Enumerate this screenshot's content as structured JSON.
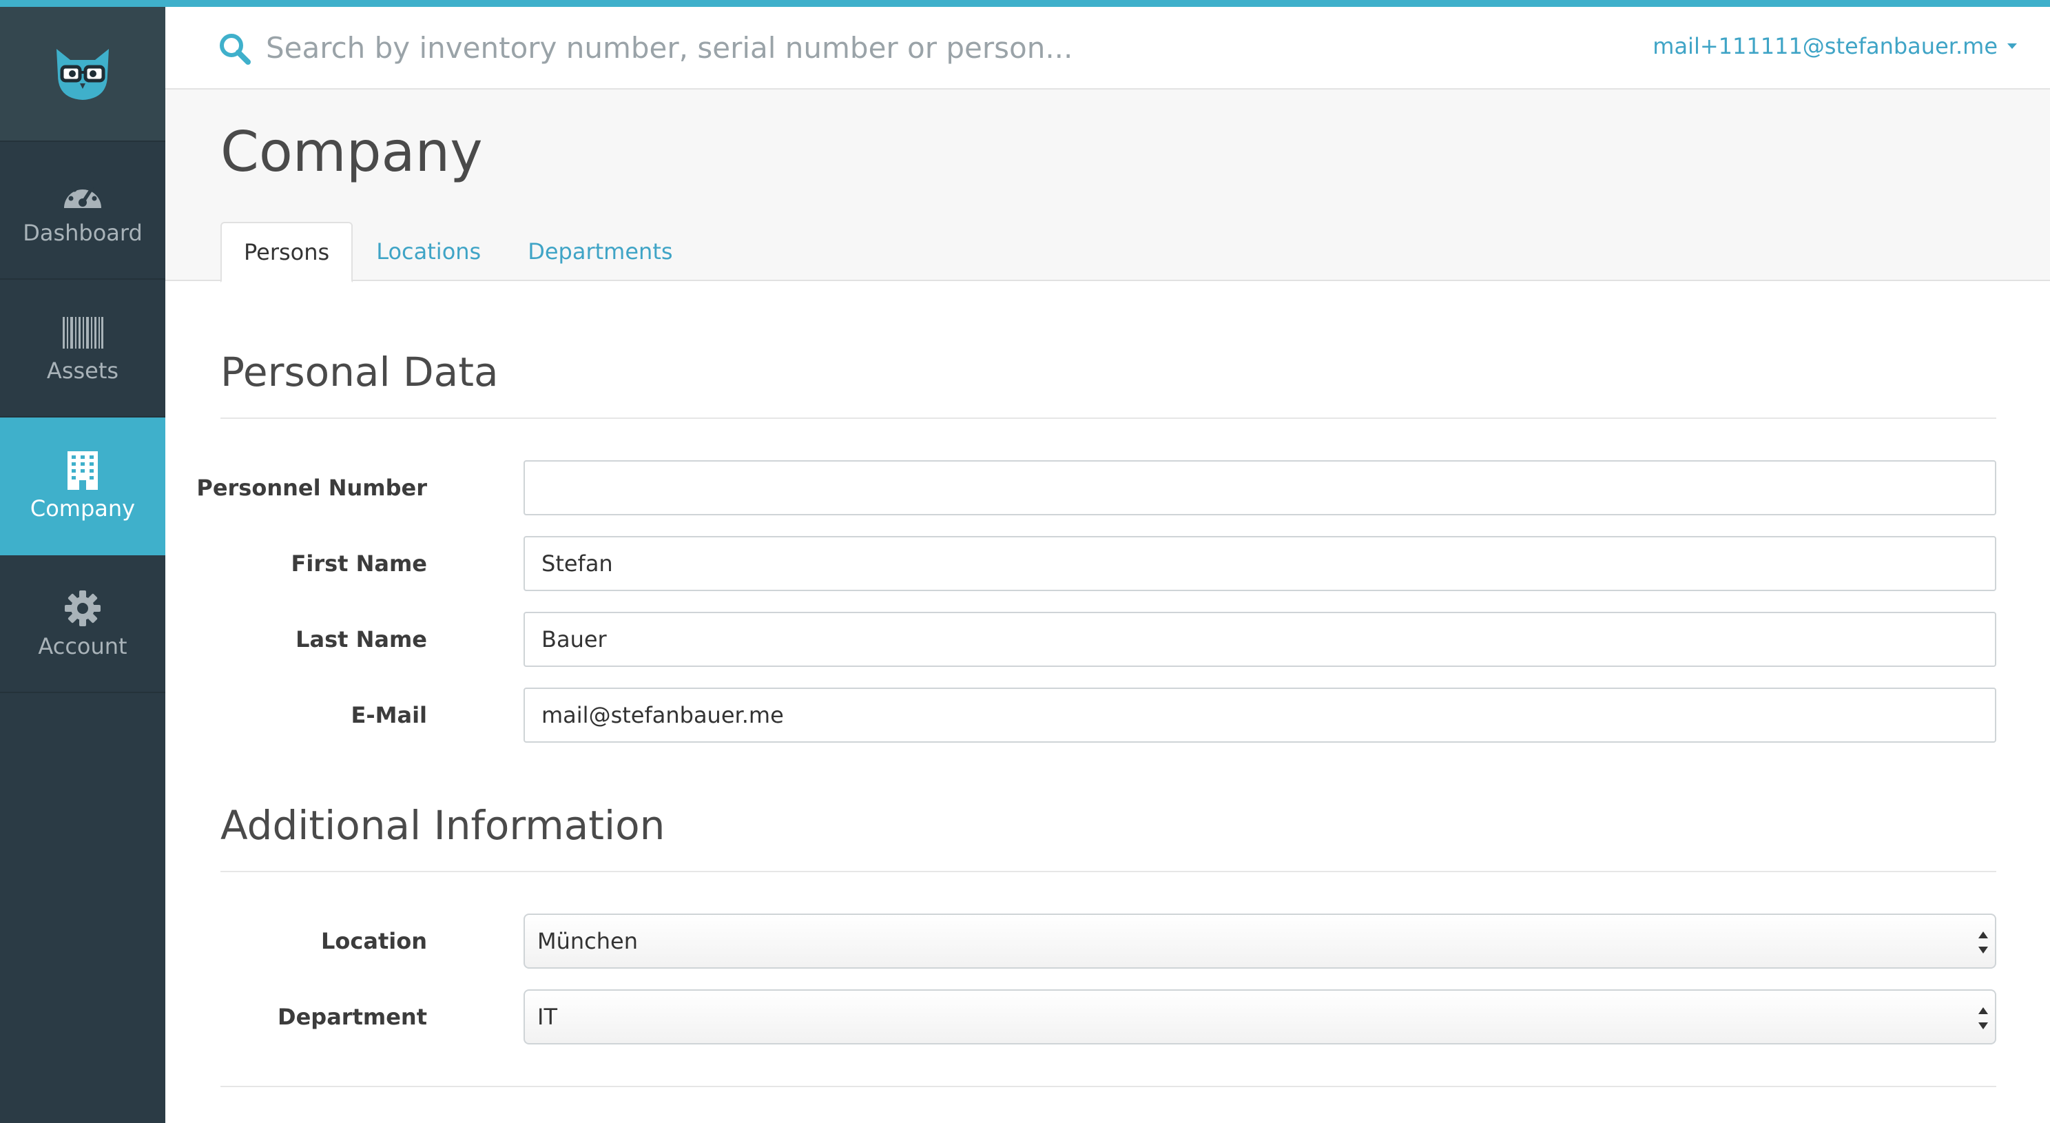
{
  "colors": {
    "accent": "#3fb0cb",
    "sidebar_bg": "#2b3b45",
    "sidebar_logo_bg": "#34474f",
    "link": "#3fa4c6",
    "title_band_bg": "#f7f7f7"
  },
  "header": {
    "search_placeholder": "Search by inventory number, serial number or person...",
    "search_icon": "search-icon",
    "user_email": "mail+111111@stefanbauer.me"
  },
  "sidebar": {
    "logo_icon": "owl-logo-icon",
    "items": [
      {
        "label": "Dashboard",
        "icon": "dashboard-gauge-icon",
        "active": false
      },
      {
        "label": "Assets",
        "icon": "barcode-icon",
        "active": false
      },
      {
        "label": "Company",
        "icon": "building-icon",
        "active": true
      },
      {
        "label": "Account",
        "icon": "gear-icon",
        "active": false
      }
    ]
  },
  "page": {
    "title": "Company",
    "tabs": [
      {
        "label": "Persons",
        "active": true
      },
      {
        "label": "Locations",
        "active": false
      },
      {
        "label": "Departments",
        "active": false
      }
    ]
  },
  "personal_data": {
    "title": "Personal Data",
    "fields": [
      {
        "label": "Personnel Number",
        "value": ""
      },
      {
        "label": "First Name",
        "value": "Stefan"
      },
      {
        "label": "Last Name",
        "value": "Bauer"
      },
      {
        "label": "E-Mail",
        "value": "mail@stefanbauer.me"
      }
    ]
  },
  "additional_info": {
    "title": "Additional Information",
    "fields": [
      {
        "label": "Location",
        "value": "München"
      },
      {
        "label": "Department",
        "value": "IT"
      }
    ]
  }
}
